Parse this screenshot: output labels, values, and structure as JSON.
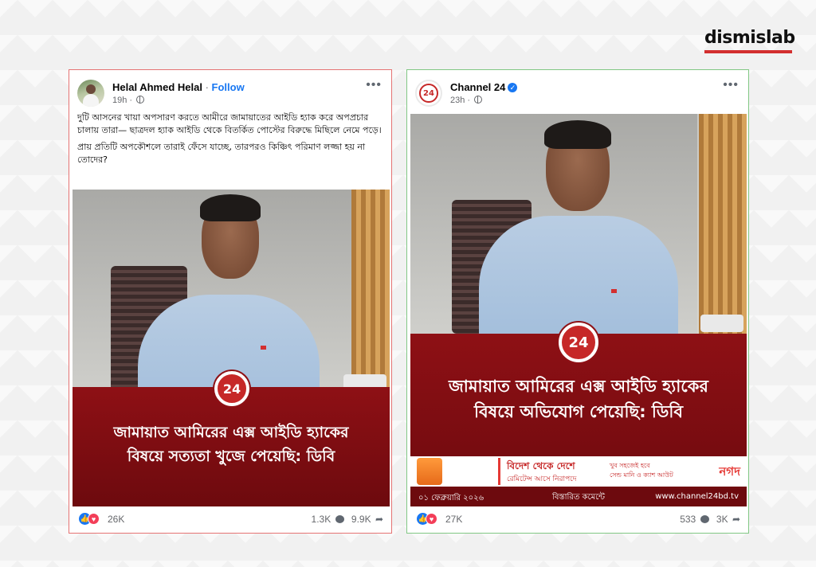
{
  "brand": {
    "logo_text": "dismislab",
    "accent_color": "#d32f2f"
  },
  "left_post": {
    "author": "Helal Ahmed Helal",
    "separator": "·",
    "follow_label": "Follow",
    "time": "19h",
    "more_icon": "more-horizontal-icon",
    "caption_p1": "দুটি আসনের খায়া অপসারণ করতে আমীরে জামায়াতের আইডি হ্যাক করে অপপ্রচার চালায় তারা— ছাত্রদল হ্যাক আইডি থেকে বিতর্কিত পোস্টের বিরুদ্ধে মিছিলে নেমে পড়ে।",
    "caption_p2": "প্রায় প্রতিটি অপকৌশলে তারাই ফেঁসে যাচ্ছে, তারপরও কিঞ্চিৎ পরিমাণ লজ্জা হয় না তোদের?",
    "image": {
      "channel_logo": "24",
      "headline_line1": "জামায়াত আমিরের এক্স আইডি হ্যাকের",
      "headline_line2": "বিষয়ে সত্যতা খুজে পেয়েছি: ডিবি"
    },
    "reaction_count": "26K",
    "comment_count": "1.3K",
    "share_count": "9.9K",
    "border_color": "#e57373"
  },
  "right_post": {
    "author": "Channel 24",
    "verified_icon": "verified-badge-icon",
    "time": "23h",
    "more_icon": "more-horizontal-icon",
    "image": {
      "channel_logo": "24",
      "headline_line1": "জামায়াত আমিরের এক্স আইডি হ্যাকের",
      "headline_line2": "বিষয়ে অভিযোগ পেয়েছি: ডিবি",
      "ad_title": "বিদেশ থেকে দেশে",
      "ad_subtitle": "রেমিটেন্স আসে নিরাপদে",
      "ad_right_line1": "খুব সহজেই হবে",
      "ad_right_line2": "সেন্ড মানি ও ক্যাশ আউট",
      "ad_brand": "নগদ",
      "date": "০১ ফেব্রুয়ারি ২০২৬",
      "details_label": "বিস্তারিত কমেন্টে",
      "website": "www.channel24bd.tv"
    },
    "reaction_count": "27K",
    "comment_count": "533",
    "share_count": "3K",
    "border_color": "#81c784"
  }
}
